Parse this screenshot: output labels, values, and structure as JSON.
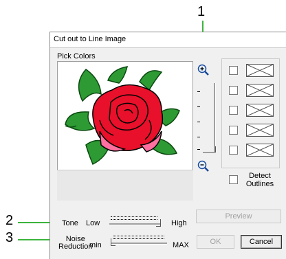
{
  "callouts": {
    "one": "1",
    "two": "2",
    "three": "3"
  },
  "dialog": {
    "title": "Cut out to Line Image",
    "pick_colors_label": "Pick Colors",
    "detect_outlines_label": "Detect Outlines",
    "tone": {
      "label": "Tone",
      "min_label": "Low",
      "max_label": "High",
      "value_fraction": 1.0
    },
    "noise": {
      "label_line1": "Noise",
      "label_line2": "Reduction",
      "min_label": "min",
      "max_label": "MAX",
      "value_fraction": 0.0
    },
    "buttons": {
      "preview": "Preview",
      "ok": "OK",
      "cancel": "Cancel"
    },
    "zoom": {
      "in_icon": "zoom-in-icon",
      "out_icon": "zoom-out-icon",
      "level_fraction": 0.0
    },
    "swatch_count": 5
  },
  "colors": {
    "callout_line": "#3cb43c",
    "rose_red": "#e8102a",
    "leaf_green": "#2e9a34"
  }
}
